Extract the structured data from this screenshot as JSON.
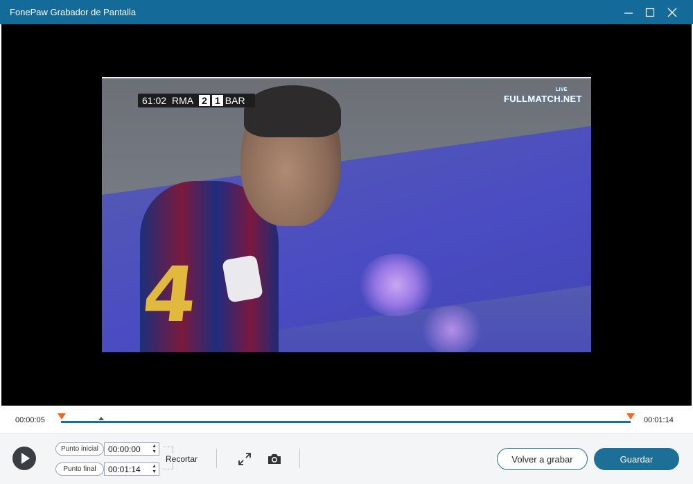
{
  "window": {
    "title": "FonePaw Grabador de Pantalla",
    "controls": {
      "minimize": "minimize-icon",
      "maximize": "maximize-icon",
      "close": "close-icon"
    }
  },
  "video": {
    "scoreboard": {
      "clock": "61:02",
      "home": "RMA",
      "home_score": "2",
      "away_score": "1",
      "away": "BAR"
    },
    "watermark": "FULLMATCH.NET",
    "watermark_badge": "LIVE",
    "shirt_number": "4"
  },
  "timeline": {
    "current_time": "00:00:05",
    "end_time": "00:01:14",
    "progress_fraction": 0.07
  },
  "controls": {
    "start_point_label": "Punto inicial",
    "start_point_value": "00:00:00",
    "end_point_label": "Punto final",
    "end_point_value": "00:01:14",
    "trim_label": "Recortar",
    "redo_label": "Volver a grabar",
    "save_label": "Guardar"
  },
  "colors": {
    "titlebar": "#146a98",
    "accent": "#1d6f97",
    "marker": "#ef6a1f"
  }
}
